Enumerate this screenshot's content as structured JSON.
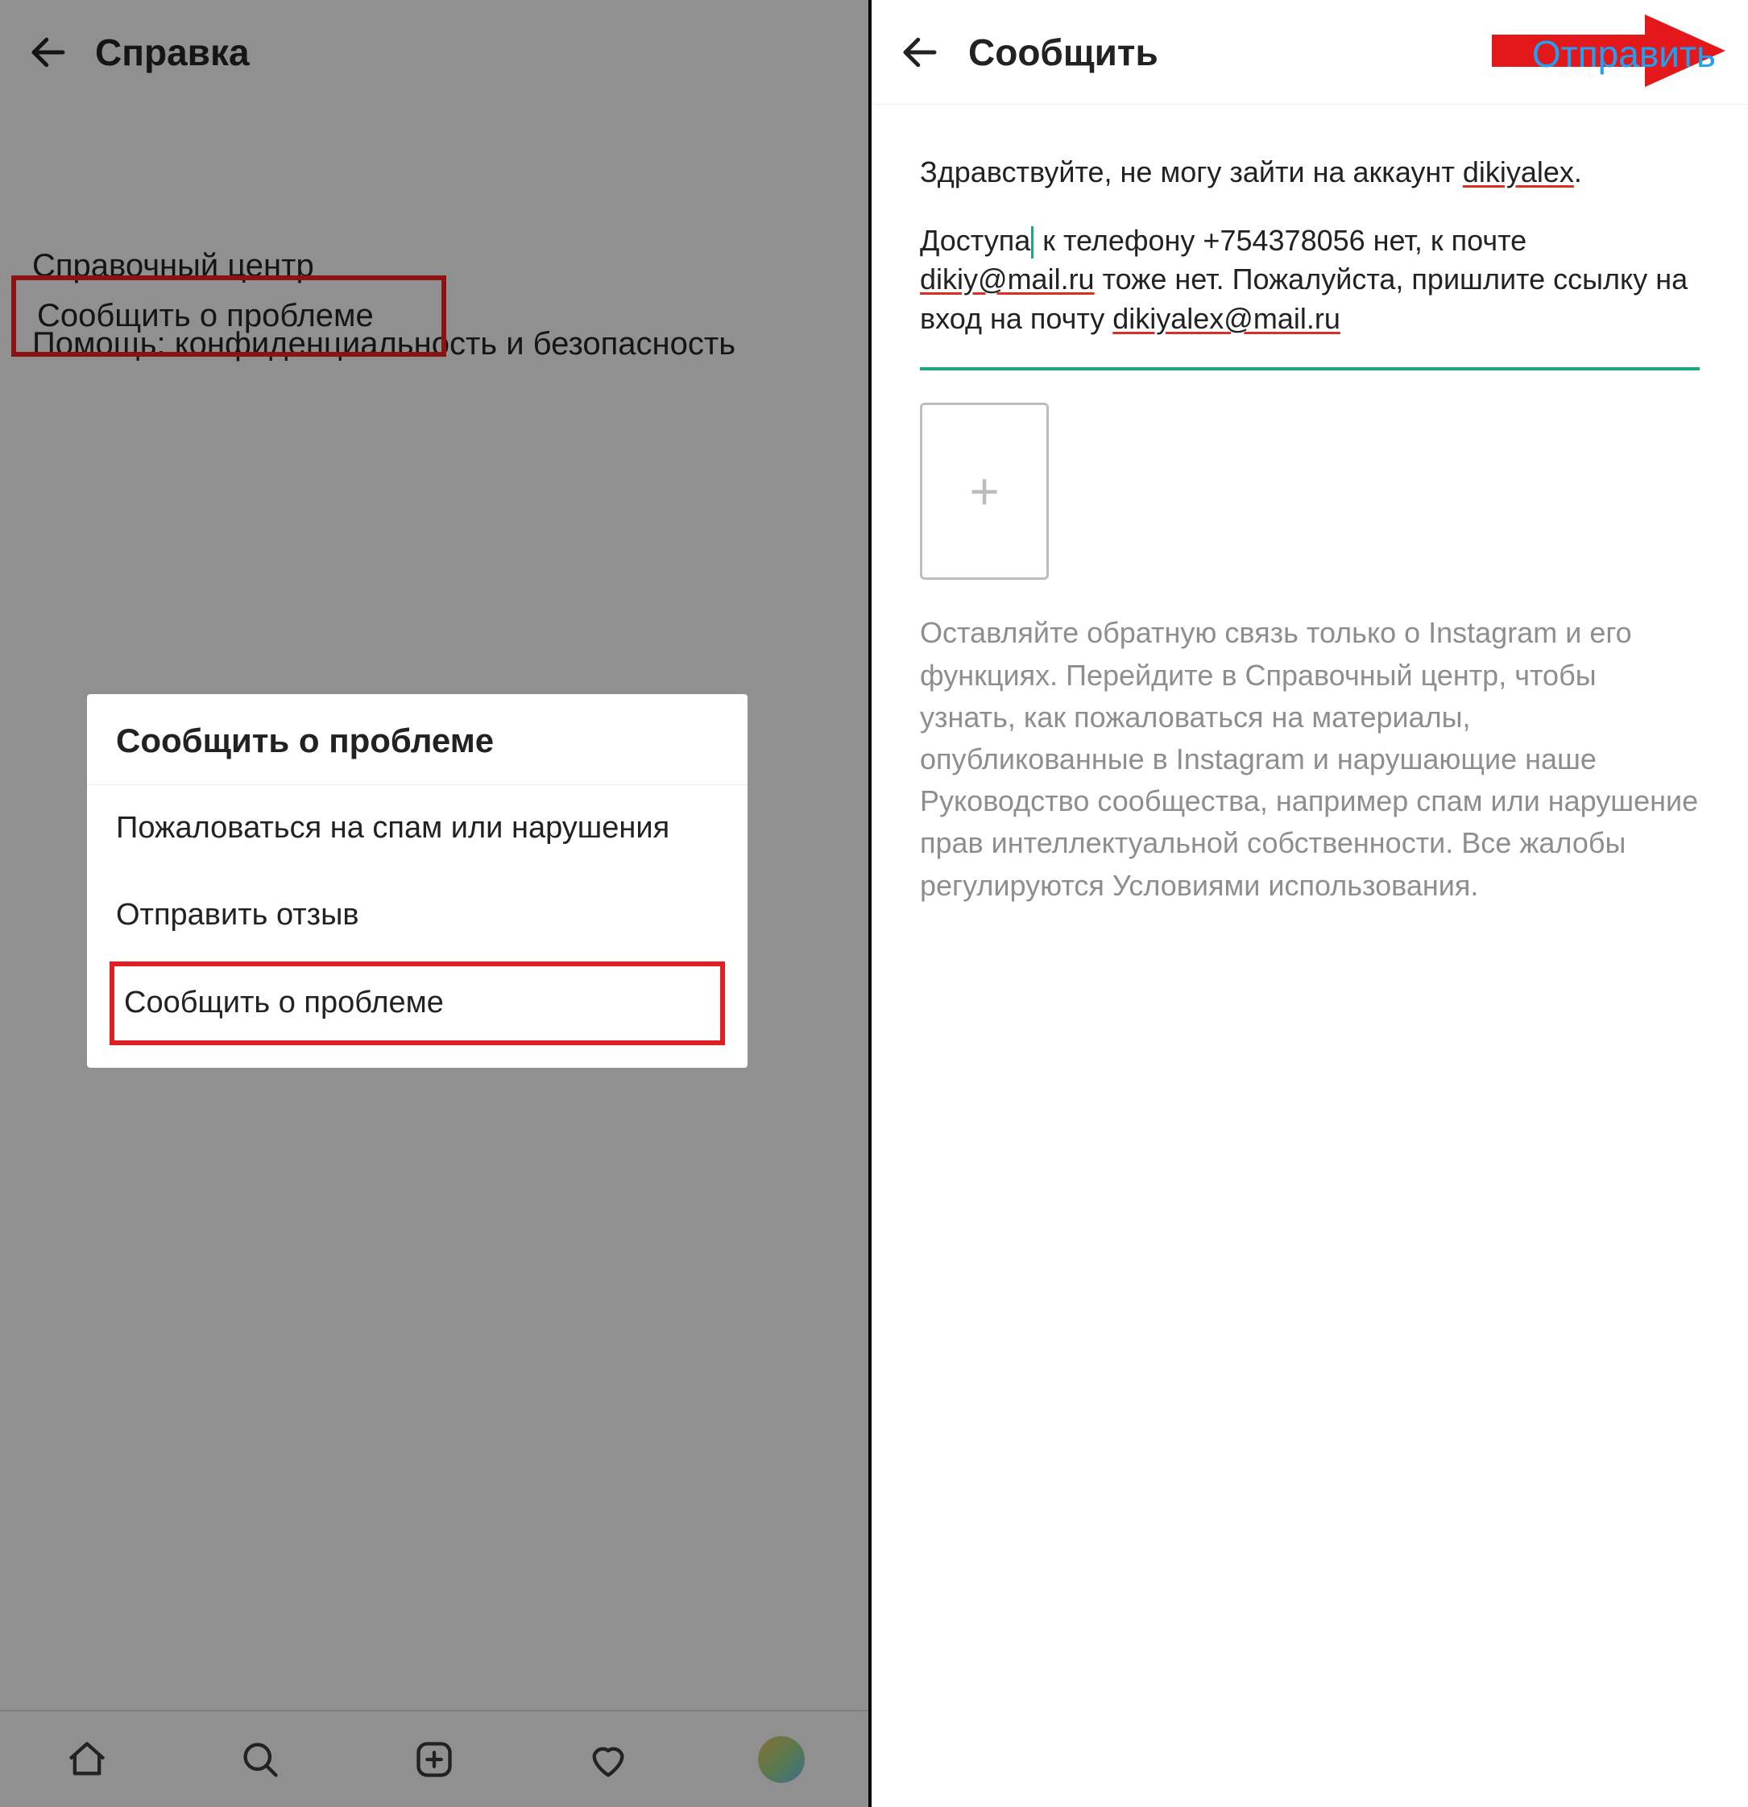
{
  "left": {
    "header_title": "Справка",
    "items": {
      "report_problem": "Сообщить  о проблеме",
      "help_center": "Справочный центр",
      "privacy_help": "Помощь: конфиденциальность и безопасность"
    },
    "modal": {
      "title": "Сообщить  о проблеме",
      "spam": "Пожаловаться на спам или нарушения",
      "feedback": "Отправить отзыв",
      "report": "Сообщить о проблеме"
    }
  },
  "right": {
    "header_title": "Сообщить",
    "send_label": "Отправить",
    "msg_part1": "Здравствуйте, не могу зайти на аккаунт ",
    "msg_user": "dikiyalex",
    "msg_dot": ".",
    "msg_p2a": "Доступа",
    "msg_p2b": " к телефону +754378056 нет, к почте ",
    "msg_mail1": "dikiy@mail.ru",
    "msg_p2c": " тоже нет. Пожалуйста, пришлите ссылку на вход на почту ",
    "msg_mail2": "dikiyalex@mail.ru",
    "info_text": "Оставляйте обратную связь только о Instagram и его функциях. Перейдите в Справочный центр, чтобы узнать, как пожаловаться на материалы, опубликованные в Instagram и нарушающие наше Руководство сообщества, например спам или нарушение прав интеллектуальной собственности. Все жалобы регулируются Условиями использования."
  },
  "colors": {
    "accent": "#1ea1f2",
    "highlight": "#e02020",
    "teal": "#1aa783"
  }
}
